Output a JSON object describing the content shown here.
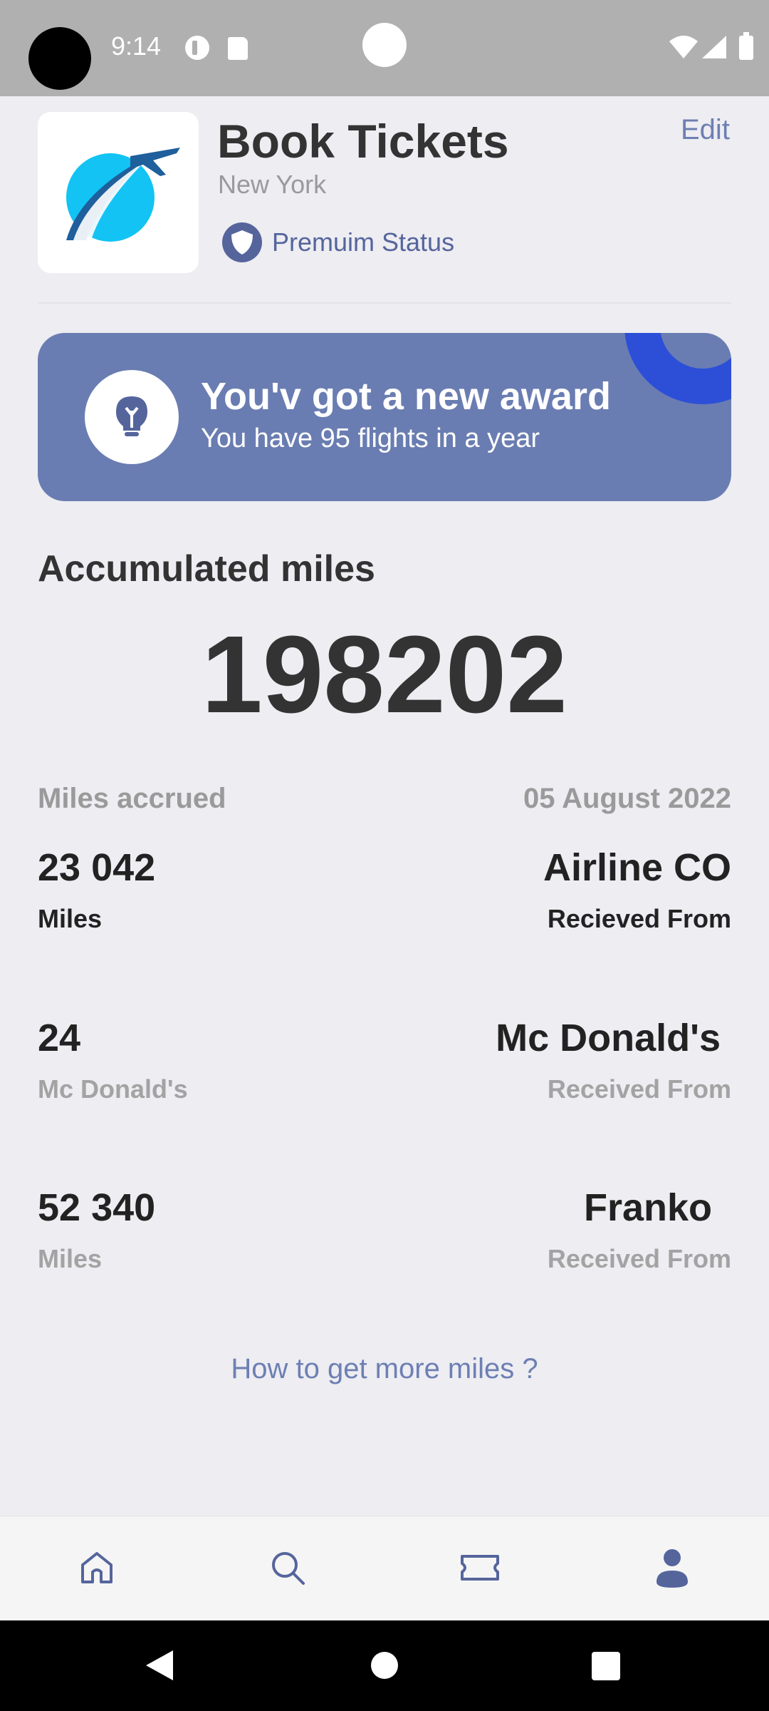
{
  "status_bar": {
    "time": "9:14"
  },
  "header": {
    "title": "Book Tickets",
    "city": "New York",
    "edit_label": "Edit",
    "premium_label": "Premuim Status"
  },
  "award": {
    "title": "You'v got a new award",
    "subtitle": "You have 95 flights in a year"
  },
  "miles": {
    "accumulated_label": "Accumulated miles",
    "accumulated_value": "198202",
    "accrued_label": "Miles accrued",
    "accrued_date": "05 August 2022",
    "rows": [
      {
        "value": "23 042",
        "value_sub": "Miles",
        "source": "Airline CO",
        "source_sub": "Recieved From"
      },
      {
        "value": "24",
        "value_sub": "Mc Donald's",
        "source": "Mc Donald's",
        "source_sub": "Received From"
      },
      {
        "value": "52 340",
        "value_sub": "Miles",
        "source": "Franko",
        "source_sub": "Received From"
      }
    ]
  },
  "more_link": "How to get more miles ?",
  "bottom_nav": {
    "items": [
      "home-icon",
      "search-icon",
      "ticket-icon",
      "profile-icon"
    ]
  },
  "colors": {
    "accent": "#6d7fb3",
    "banner": "#6a7db2",
    "premium": "#55659c",
    "deco": "#2d4fd8"
  }
}
